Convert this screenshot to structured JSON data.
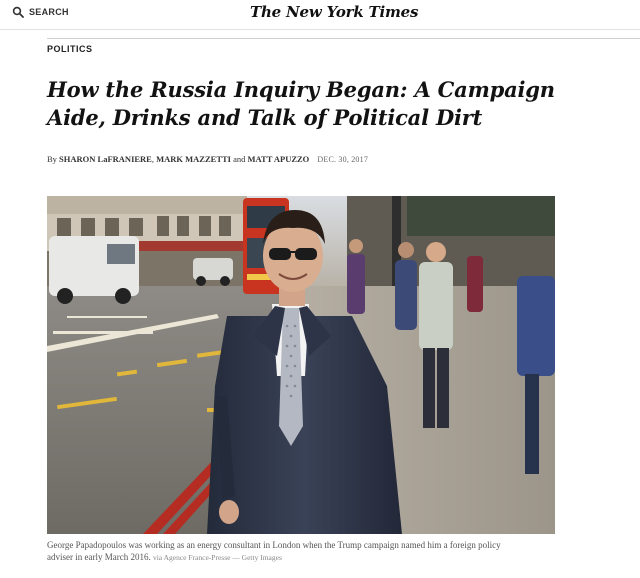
{
  "header": {
    "search_label": "SEARCH",
    "masthead": "The New York Times"
  },
  "article": {
    "section": "POLITICS",
    "headline": "How the Russia Inquiry Began: A Campaign Aide, Drinks and Talk of Political Dirt",
    "byline_prefix": "By",
    "authors": [
      "SHARON LaFRANIERE",
      "MARK MAZZETTI",
      "MATT APUZZO"
    ],
    "byline_sep": ",",
    "byline_and": "and",
    "date": "DEC. 30, 2017",
    "caption": "George Papadopoulos was working as an energy consultant in London when the Trump campaign named him a foreign policy adviser in early March 2016.",
    "credit": "via Agence France-Presse — Getty Images"
  },
  "icons": {
    "search": "search-icon",
    "photo": "street-photo"
  },
  "colors": {
    "text": "#121212",
    "rule": "#cfcfcf",
    "bus_red": "#c8341f"
  }
}
